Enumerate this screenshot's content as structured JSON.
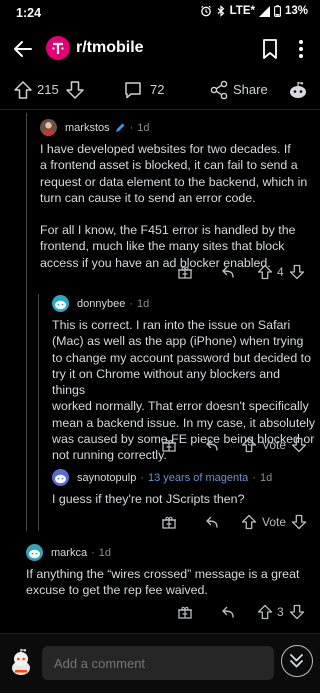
{
  "status_bar": {
    "time": "1:24",
    "network": "LTE*",
    "battery": "13%"
  },
  "header": {
    "subreddit": "r/tmobile"
  },
  "post_actions": {
    "score": "215",
    "comments": "72",
    "share": "Share"
  },
  "comments": [
    {
      "username": "markstos",
      "time": "1d",
      "paragraphs": [
        [
          "I have developed websites for two decades. If",
          "a frontend asset is blocked, it can fail to send a",
          "request or data element to the backend, which in",
          "turn can cause it to send an error code."
        ],
        [
          "For all I know, the F451 error is handled by the",
          "frontend, much like the many sites that block",
          "access if you have an ad blocker enabled."
        ]
      ],
      "votes": "4"
    },
    {
      "username": "donnybee",
      "time": "1d",
      "lines": [
        "This is correct. I ran into the issue on Safari",
        "(Mac) as well as the app (iPhone) when trying",
        "to change my account password but decided to",
        "try it on Chrome without any blockers and things",
        "worked normally. That error doesn't specifically",
        "mean a backend issue. In my case, it absolutely",
        "was caused by some FE piece being blocked or",
        "not running correctly."
      ],
      "votes": "Vote"
    },
    {
      "username": "saynotopulp",
      "flair": "13 years of magenta",
      "time": "1d",
      "lines": [
        "I guess if they're not JScripts then?"
      ],
      "votes": "Vote"
    },
    {
      "username": "markca",
      "time": "1d",
      "lines": [
        "If anything the “wires crossed” message is a great",
        "excuse to get the rep fee waived."
      ],
      "votes": "3"
    }
  ],
  "bottom_bar": {
    "placeholder": "Add a comment"
  },
  "colors": {
    "accent_tmobile": "#e20074",
    "background": "#000000",
    "text": "#d7dadc"
  }
}
